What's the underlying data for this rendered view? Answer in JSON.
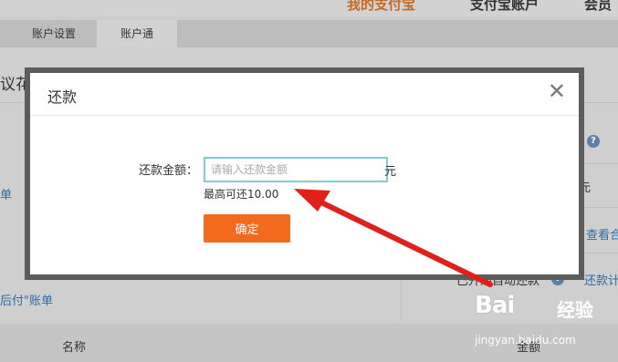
{
  "background": {
    "nav": [
      {
        "label": "我的支付宝",
        "active": true
      },
      {
        "label": "支付宝账户",
        "active": false
      },
      {
        "label": "会员",
        "active": false
      }
    ],
    "subtabs": [
      "账户设置",
      "账户通"
    ],
    "page_title_fragment": "议花",
    "left_link_1": "单",
    "left_link_2": "后付\"账单",
    "right_text_1": "元",
    "right_link_1": "查看合",
    "right_link_2": "还款计",
    "auto_repay_text": "已开通自动还款",
    "table_header_name": "名称",
    "table_header_amount": "金额"
  },
  "modal": {
    "title": "还款",
    "close_glyph": "✕",
    "amount_label": "还款金额：",
    "amount_value": "",
    "amount_placeholder": "请输入还款金额",
    "unit": "元",
    "max_hint": "最高可还10.00",
    "confirm_label": "确定"
  },
  "watermark": {
    "logo": "Bai",
    "brand": "经验",
    "url": "jingyan.baidu.com"
  },
  "colors": {
    "accent": "#f26a1e",
    "input_border": "#7ecfdb",
    "arrow": "#e0201b",
    "link": "#2a6da8"
  }
}
